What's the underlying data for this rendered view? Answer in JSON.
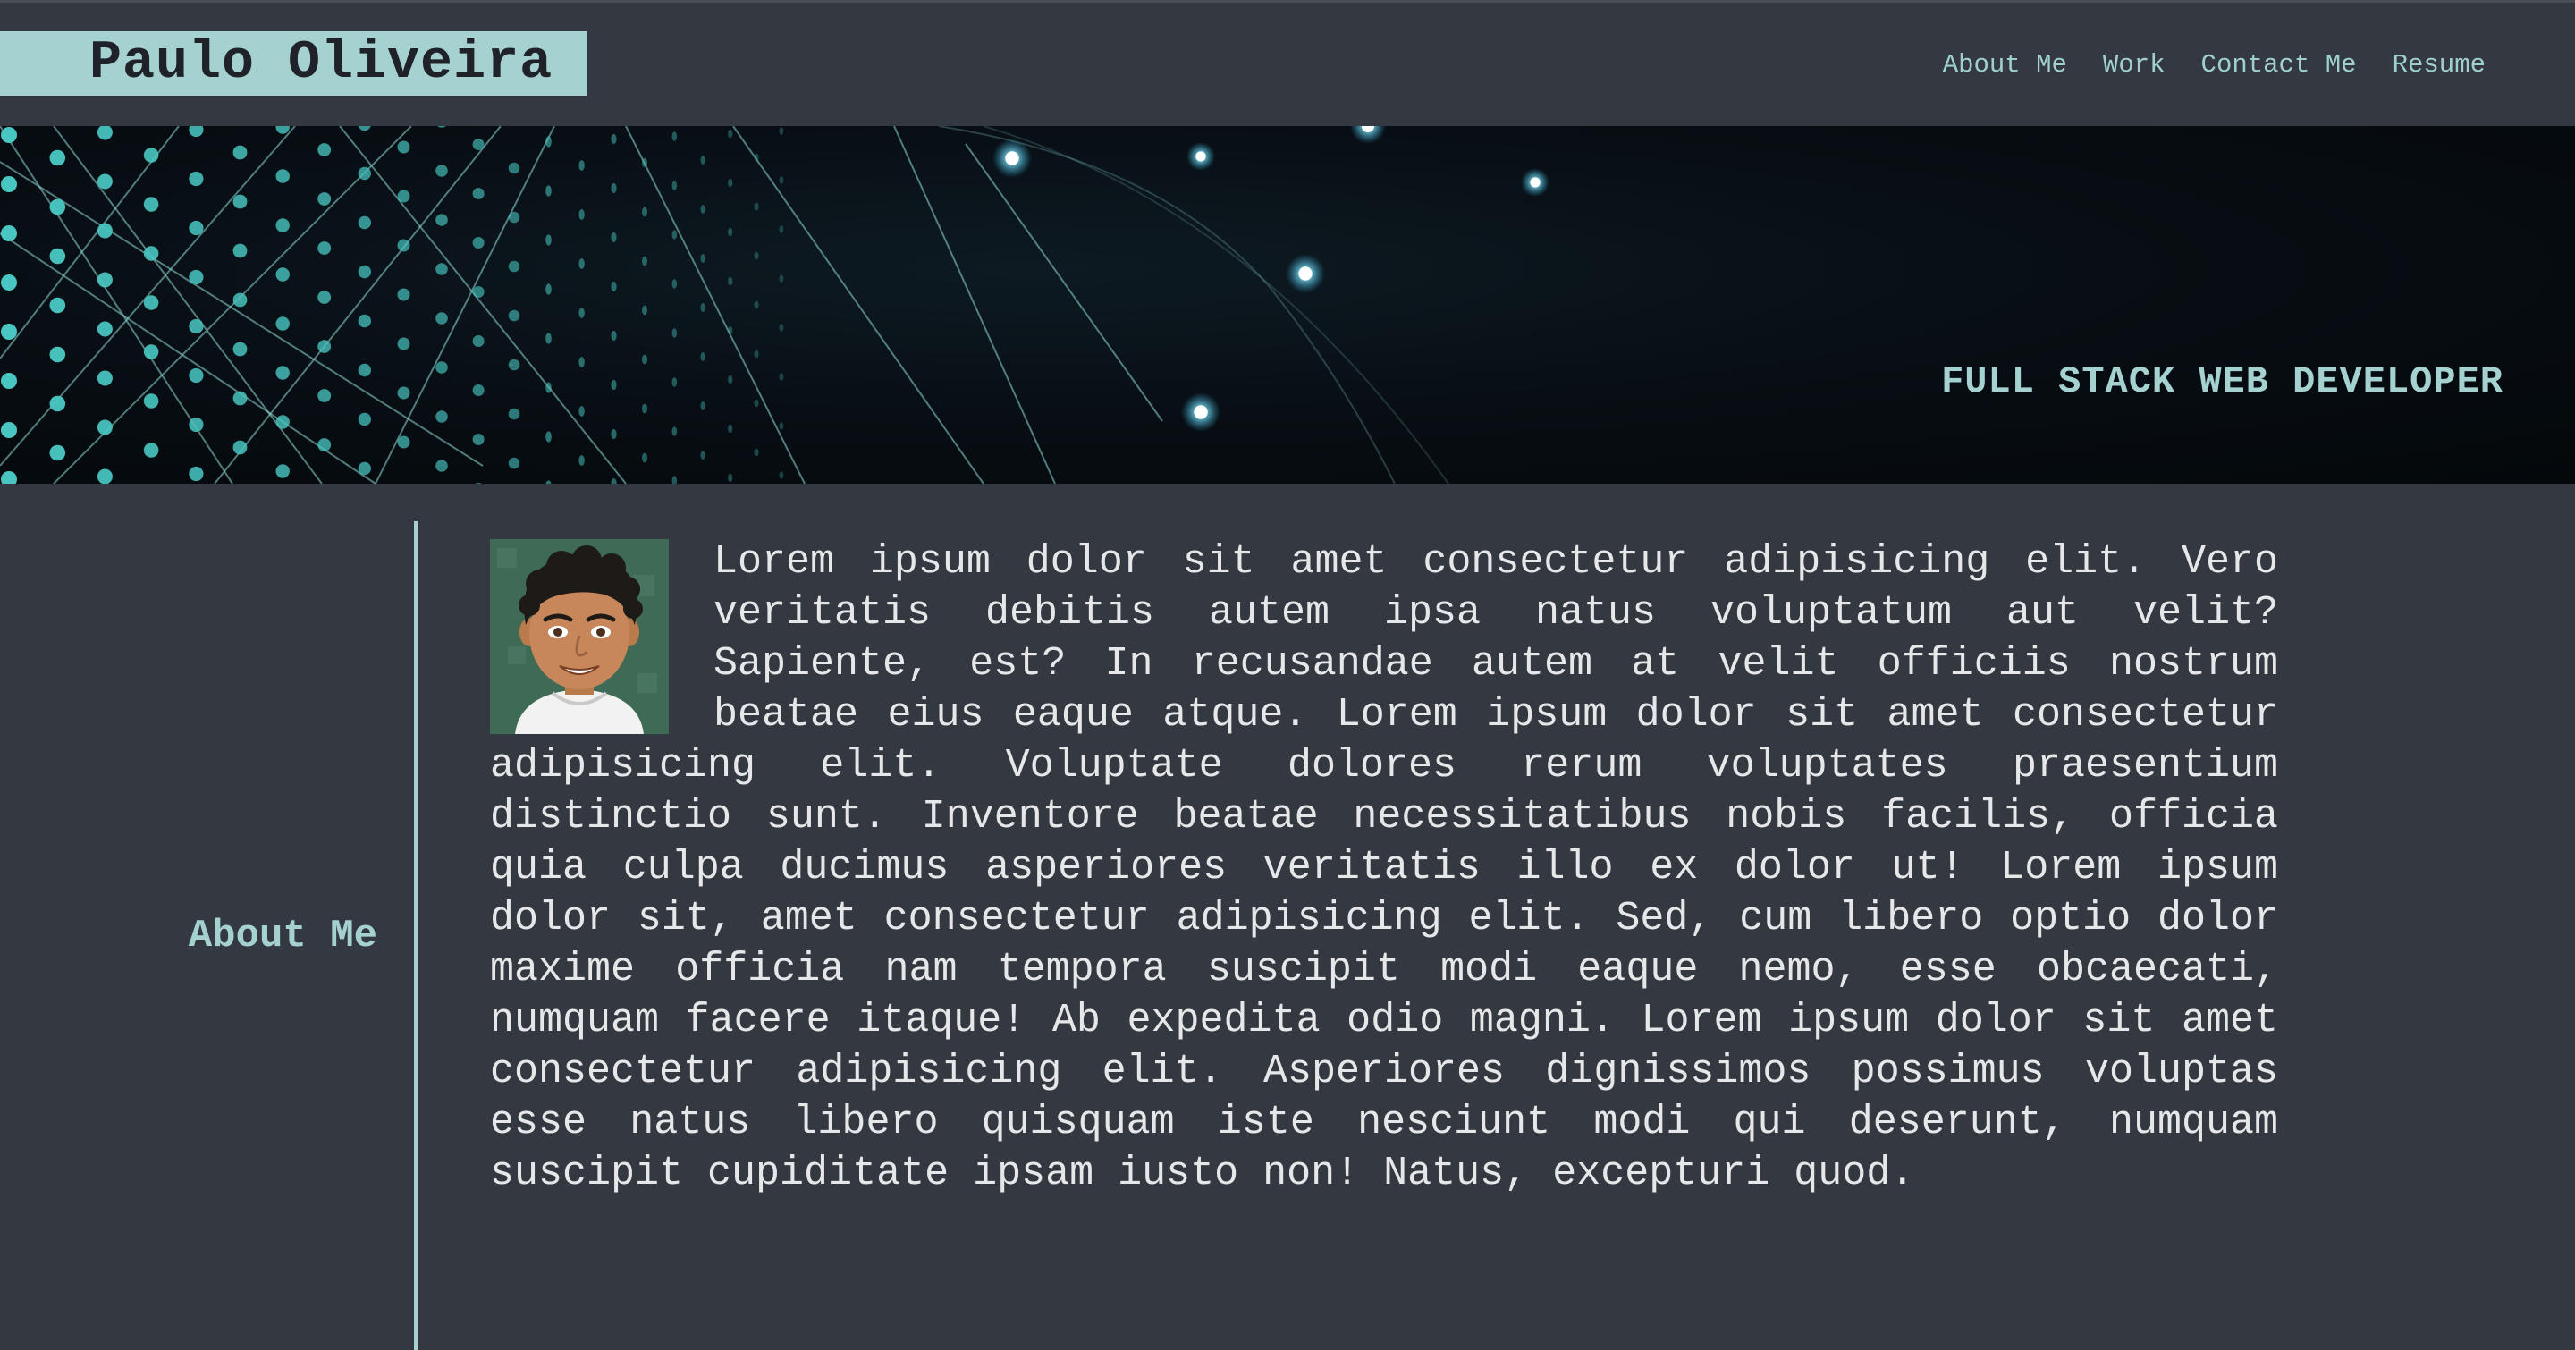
{
  "header": {
    "logo_text": "Paulo Oliveira",
    "nav": [
      {
        "label": "About Me"
      },
      {
        "label": "Work"
      },
      {
        "label": "Contact Me"
      },
      {
        "label": "Resume"
      }
    ]
  },
  "hero": {
    "tagline": "FULL STACK WEB DEVELOPER"
  },
  "about": {
    "section_label": "About Me",
    "avatar_icon": "bitmoji-avatar",
    "bio": "Lorem ipsum dolor sit amet consectetur adipisicing elit. Vero veritatis debitis autem ipsa natus voluptatum aut velit? Sapiente, est? In recusandae autem at velit officiis nostrum beatae eius eaque atque. Lorem ipsum dolor sit amet consectetur adipisicing elit. Voluptate dolores rerum voluptates praesentium distinctio sunt. Inventore beatae necessitatibus nobis facilis, officia quia culpa ducimus asperiores veritatis illo ex dolor ut! Lorem ipsum dolor sit, amet consectetur adipisicing elit. Sed, cum libero optio dolor maxime officia nam tempora suscipit modi eaque nemo, esse obcaecati, numquam facere itaque! Ab expedita odio magni. Lorem ipsum dolor sit amet consectetur adipisicing elit. Asperiores dignissimos possimus voluptas esse natus libero quisquam iste nesciunt modi qui deserunt, numquam suscipit cupiditate ipsam iusto non! Natus, excepturi quod."
  },
  "colors": {
    "background": "#343840",
    "accent": "#a5d2d0",
    "text": "#e6e7e8",
    "hero_dot": "#49c6c2"
  }
}
